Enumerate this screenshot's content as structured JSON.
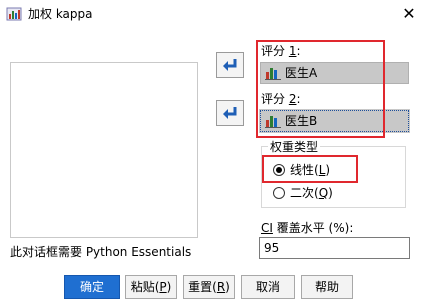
{
  "window": {
    "title": "加权 kappa",
    "close_symbol": "✕"
  },
  "source_panel": {
    "footnote": "此对话框需要 Python Essentials"
  },
  "rater1": {
    "label_prefix": "评分 ",
    "label_num": "1",
    "label_suffix": ":",
    "variable": "医生A",
    "icon": "scale-variable-icon"
  },
  "rater2": {
    "label_prefix": "评分 ",
    "label_num": "2",
    "label_suffix": ":",
    "variable": "医生B",
    "icon": "scale-variable-icon"
  },
  "weighting": {
    "title": "权重类型",
    "options": [
      {
        "pre": "线性(",
        "key": "L",
        "post": ")",
        "selected": true
      },
      {
        "pre": "二次(",
        "key": "Q",
        "post": ")",
        "selected": false
      }
    ]
  },
  "ci": {
    "label_key": "CI",
    "label_rest": " 覆盖水平 (%):",
    "value": "95"
  },
  "buttons": {
    "ok": "确定",
    "paste": {
      "pre": "粘贴(",
      "key": "P",
      "post": ")"
    },
    "reset": {
      "pre": "重置(",
      "key": "R",
      "post": ")"
    },
    "cancel": "取消",
    "help": "帮助"
  },
  "colors": {
    "highlight": "#e0282e",
    "primary_button": "#1f6fd1",
    "variable_field": "#c8c8c8"
  }
}
